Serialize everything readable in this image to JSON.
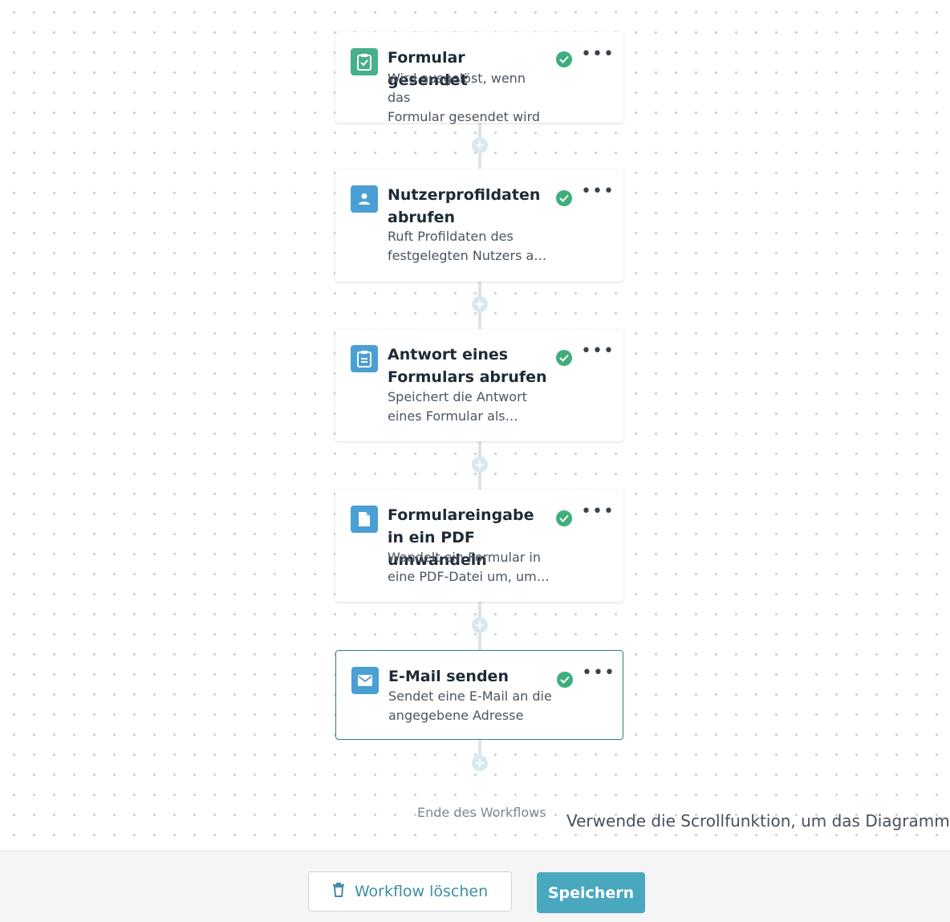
{
  "workflow": {
    "steps": [
      {
        "title": "Formular gesendet",
        "description_line1": "Wird ausgelöst, wenn das",
        "description_line2": "Formular gesendet wird",
        "icon": "clipboard-check-icon",
        "icon_color": "#46b08a",
        "status": "complete"
      },
      {
        "title": "Nutzerprofildaten abrufen",
        "description_line1": "Ruft Profildaten des",
        "description_line2": "festgelegten Nutzers a…",
        "icon": "user-icon",
        "icon_color": "#4a9fd4",
        "status": "complete"
      },
      {
        "title": "Antwort eines Formulars abrufen",
        "description_line1": "Speichert die Antwort",
        "description_line2": "eines Formular als…",
        "icon": "clipboard-list-icon",
        "icon_color": "#4a9fd4",
        "status": "complete"
      },
      {
        "title": "Formulareingabe in ein PDF umwandeln",
        "description_line1": "Wandelt ein Formular in",
        "description_line2": "eine PDF-Datei um, um…",
        "icon": "document-icon",
        "icon_color": "#4a9fd4",
        "status": "complete"
      },
      {
        "title": "E-Mail senden",
        "description_line1": "Sendet eine E-Mail an die",
        "description_line2": "angegebene Adresse",
        "icon": "envelope-icon",
        "icon_color": "#4a9fd4",
        "status": "complete",
        "selected": true
      }
    ],
    "more_symbol": "•••",
    "end_label": "Ende des Workflows",
    "scroll_hint": "Verwende die Scrollfunktion, um das Diagramm zu"
  },
  "footer": {
    "delete_label": "Workflow löschen",
    "save_label": "Speichern"
  },
  "colors": {
    "accent": "#4aa8be",
    "success": "#3fae7c"
  }
}
